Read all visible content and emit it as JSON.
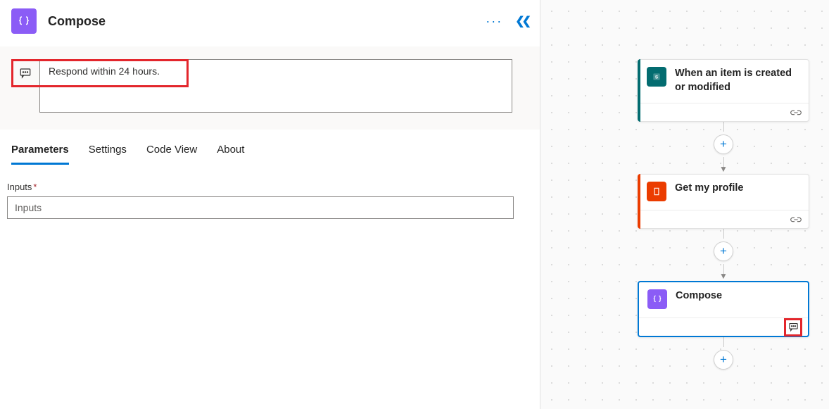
{
  "header": {
    "title": "Compose",
    "icon": "code-braces-icon"
  },
  "note": {
    "text": "Respond within 24 hours."
  },
  "tabs": [
    {
      "label": "Parameters",
      "active": true
    },
    {
      "label": "Settings",
      "active": false
    },
    {
      "label": "Code View",
      "active": false
    },
    {
      "label": "About",
      "active": false
    }
  ],
  "form": {
    "inputs_label": "Inputs",
    "inputs_required_marker": "*",
    "inputs_placeholder": "Inputs"
  },
  "flow": {
    "cards": [
      {
        "title": "When an item is created or modified",
        "icon": "sharepoint-icon",
        "accent": "#036c70",
        "selected": false,
        "footer_icon": "link-icon"
      },
      {
        "title": "Get my profile",
        "icon": "office-icon",
        "accent": "#eb3c00",
        "selected": false,
        "footer_icon": "link-icon"
      },
      {
        "title": "Compose",
        "icon": "code-braces-icon",
        "accent": "#8b5cf6",
        "selected": true,
        "footer_icon": "note-icon",
        "footer_highlighted": true
      }
    ]
  }
}
